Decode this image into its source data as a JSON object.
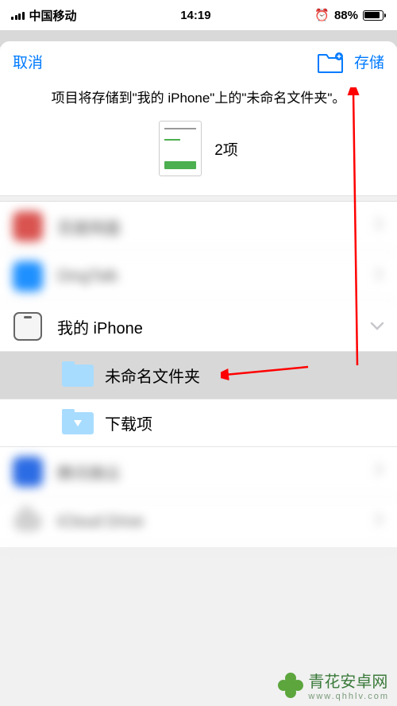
{
  "status": {
    "carrier": "中国移动",
    "time": "14:19",
    "battery_pct": "88%"
  },
  "toolbar": {
    "cancel": "取消",
    "save": "存储"
  },
  "header": {
    "info_text": "项目将存储到\"我的 iPhone\"上的\"未命名文件夹\"。",
    "item_count": "2项"
  },
  "locations": [
    {
      "id": "blurred-1",
      "label": "百度网盘",
      "icon": "app",
      "icon_color": "#d9534f",
      "blurred": true,
      "chevron": "right"
    },
    {
      "id": "blurred-2",
      "label": "DingTalk",
      "icon": "app",
      "icon_color": "#1e90ff",
      "blurred": true,
      "chevron": "right"
    },
    {
      "id": "on-my-iphone",
      "label": "我的 iPhone",
      "icon": "phone",
      "blurred": false,
      "chevron": "down"
    },
    {
      "id": "unnamed-folder",
      "label": "未命名文件夹",
      "icon": "folder-light",
      "blurred": false,
      "sub": true,
      "selected": true
    },
    {
      "id": "downloads",
      "label": "下载项",
      "icon": "folder-dl",
      "blurred": false,
      "sub": true
    },
    {
      "id": "blurred-3",
      "label": "腾讯微云",
      "icon": "app",
      "icon_color": "#2b6be4",
      "blurred": true,
      "chevron": "right"
    },
    {
      "id": "icloud-drive",
      "label": "iCloud Drive",
      "icon": "cloud",
      "blurred": true,
      "chevron": "right"
    }
  ],
  "watermark": {
    "title": "青花安卓网",
    "sub": "www.qhhlv.com"
  }
}
